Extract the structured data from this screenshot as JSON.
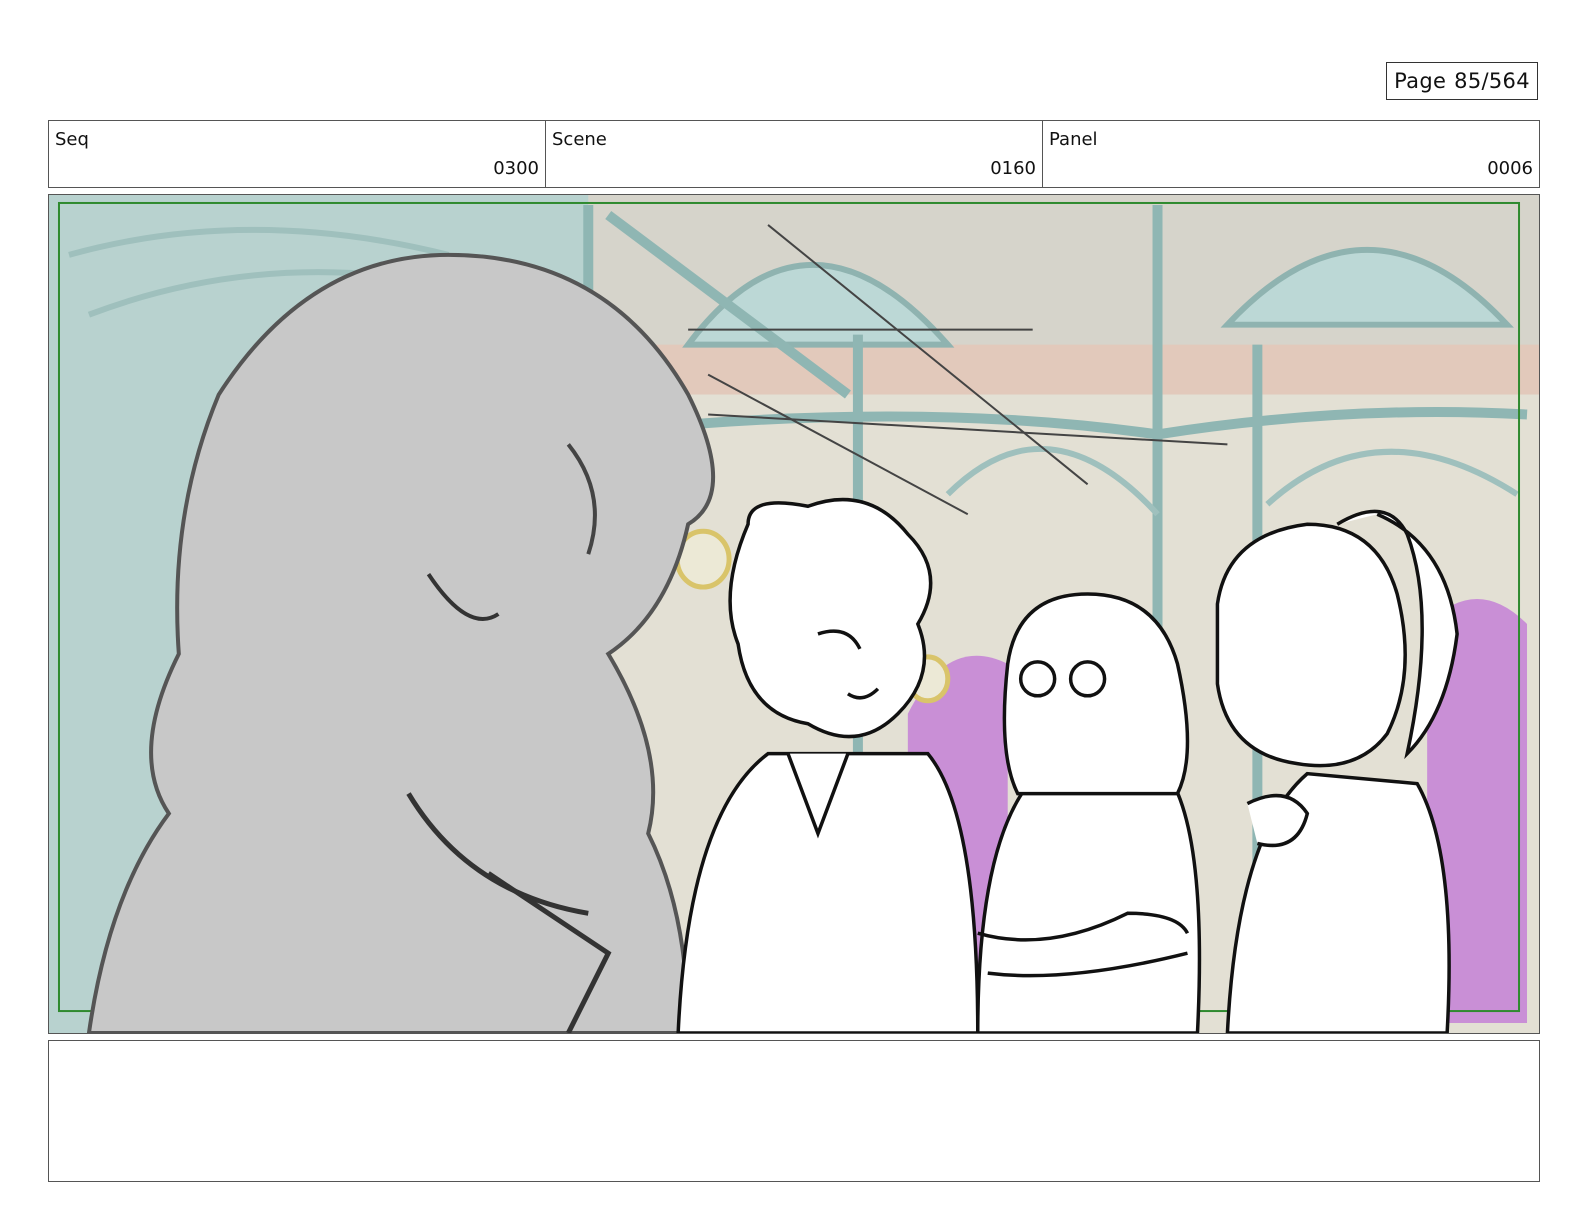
{
  "page": {
    "prefix": "Page",
    "number": "85/564"
  },
  "header": {
    "seq": {
      "label": "Seq",
      "value": "0300"
    },
    "scene": {
      "label": "Scene",
      "value": "0160"
    },
    "panel": {
      "label": "Panel",
      "value": "0006"
    }
  },
  "notes": {
    "text": ""
  },
  "colors": {
    "frame_safe_line": "#2f8a2f",
    "bg_teal": "#b9d3d0",
    "bg_cream": "#e6e2d6",
    "bg_magenta": "#c98fd6",
    "sketch_grey": "#c9c9c9",
    "lamp_gold": "#d9c46a"
  }
}
